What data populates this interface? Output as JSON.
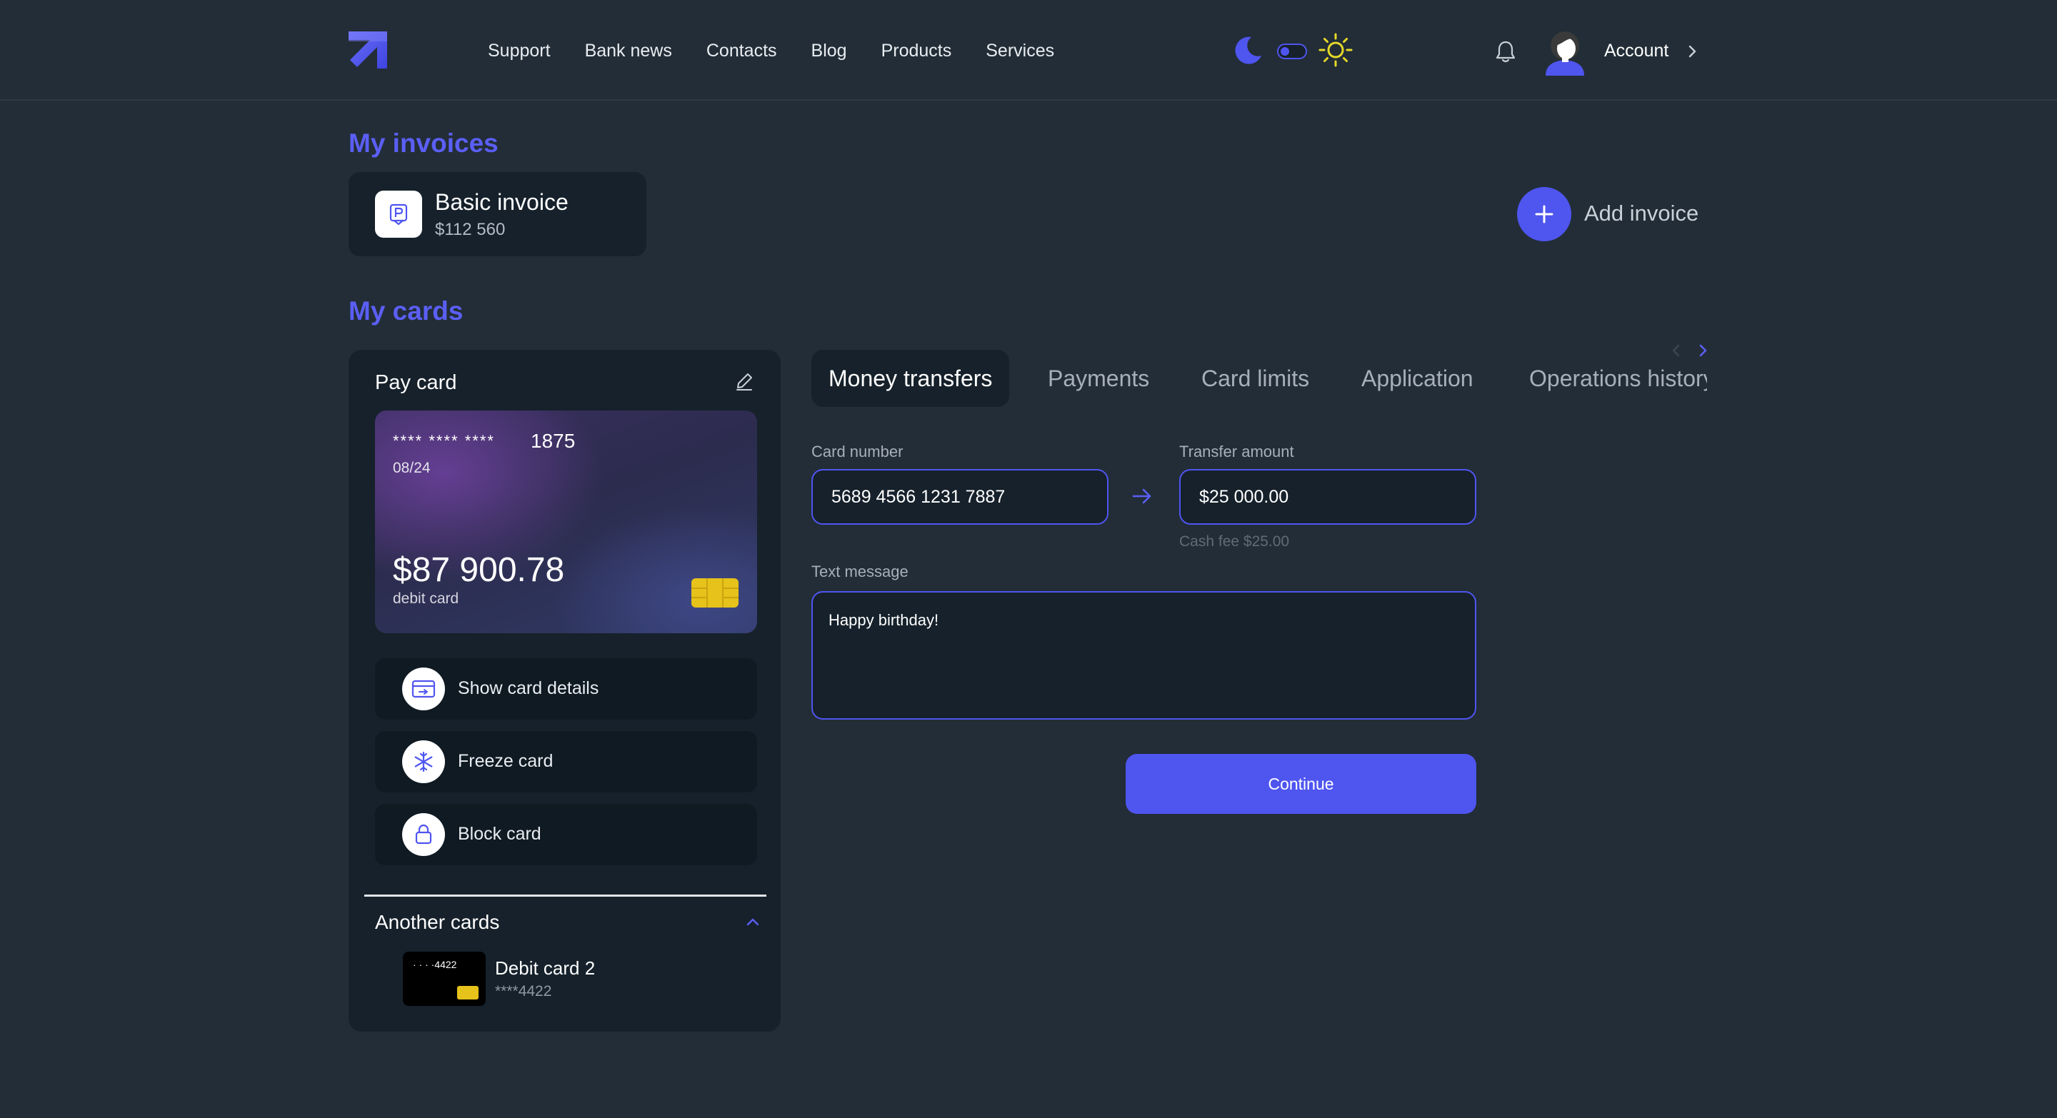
{
  "header": {
    "nav": [
      "Support",
      "Bank news",
      "Contacts",
      "Blog",
      "Products",
      "Services"
    ],
    "account_label": "Account"
  },
  "invoices": {
    "title": "My invoices",
    "items": [
      {
        "name": "Basic invoice",
        "amount": "$112 560"
      }
    ],
    "add_label": "Add invoice"
  },
  "cards": {
    "title": "My cards",
    "pay_card": {
      "title": "Pay card",
      "mask": "**** **** ****",
      "last4": "1875",
      "expiry": "08/24",
      "balance": "$87 900.78",
      "type": "debit card"
    },
    "actions": [
      {
        "label": "Show card details",
        "icon": "card-details-icon"
      },
      {
        "label": "Freeze card",
        "icon": "snowflake-icon"
      },
      {
        "label": "Block card",
        "icon": "lock-icon"
      }
    ],
    "another": {
      "title": "Another cards",
      "items": [
        {
          "name": "Debit card 2",
          "mini_mask": "· · · ·4422",
          "number": "****4422"
        }
      ]
    }
  },
  "tabs": {
    "items": [
      "Money transfers",
      "Payments",
      "Card limits",
      "Application",
      "Operations history"
    ],
    "active": 0
  },
  "form": {
    "card_number_label": "Card number",
    "card_number_value": "5689 4566 1231 7887",
    "amount_label": "Transfer amount",
    "amount_value": "$25 000.00",
    "fee_note": "Cash fee $25.00",
    "message_label": "Text message",
    "message_value": "Happy birthday!",
    "continue_label": "Continue"
  },
  "colors": {
    "background": "#222d37",
    "panel": "#16212b",
    "accent": "#4f55ef",
    "title_accent": "#5b5ff5"
  }
}
